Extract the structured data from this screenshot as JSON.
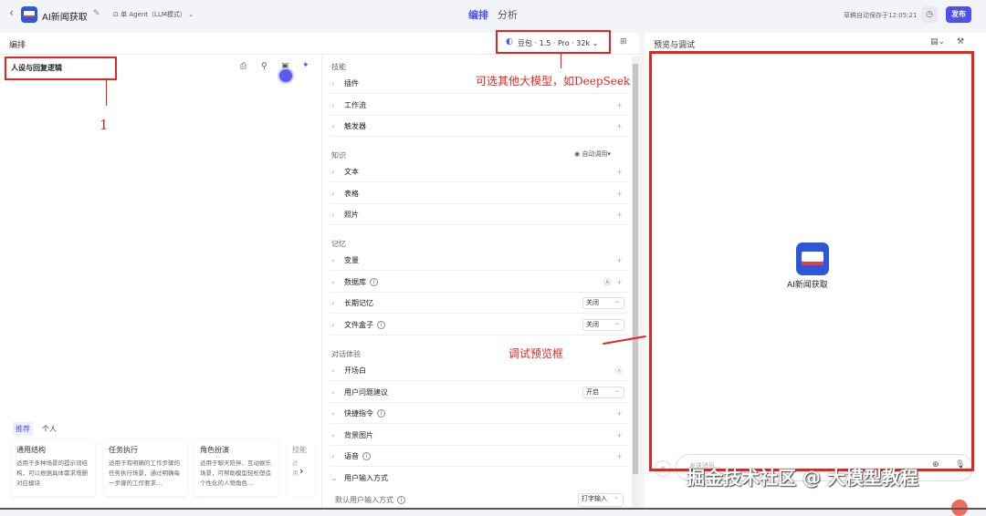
{
  "topbar": {
    "back": "‹",
    "app_name": "AI新闻获取",
    "mode": "单 Agent（LLM模式）",
    "tabs": [
      "编排",
      "分析"
    ],
    "autosave": "草稿自动保存于12:05:21",
    "publish": "发布"
  },
  "left": {
    "title": "编排",
    "persona_title": "人设与回复逻辑",
    "template_tabs": [
      "推荐",
      "个人"
    ],
    "cards": [
      {
        "title": "通用结构",
        "desc": "适用于多种场景的提示词结构，可以根据具体需求增删对应模块"
      },
      {
        "title": "任务执行",
        "desc": "适用于有明确的工作步骤的任务执行场景，通过明确每一步骤的工作要求…"
      },
      {
        "title": "角色扮演",
        "desc": "适用于聊天陪伴、互动娱乐场景，可帮助模型轻松塑造个性化的人物角色…"
      },
      {
        "title": "技能",
        "desc": "适用…"
      }
    ]
  },
  "model": {
    "label": "豆包 · 1.5 · Pro · 32k"
  },
  "mid": {
    "sections": {
      "skills": "技能",
      "knowledge": "知识",
      "memory": "记忆",
      "dialog": "对话体验"
    },
    "auto_call": "自动调用",
    "skills": [
      "插件",
      "工作流",
      "触发器"
    ],
    "knowledge": [
      "文本",
      "表格",
      "照片"
    ],
    "memory": {
      "var": "变量",
      "db": "数据库",
      "long": "长期记忆",
      "long_val": "关闭",
      "files": "文件盒子",
      "files_val": "关闭"
    },
    "dialog": {
      "opening": "开场白",
      "suggest": "用户问题建议",
      "suggest_val": "开启",
      "shortcut": "快捷指令",
      "bg": "背景图片",
      "voice": "语音",
      "input_mode": "用户输入方式",
      "default_input": "默认用户输入方式",
      "default_input_val": "打字输入"
    }
  },
  "right": {
    "title": "预览与调试",
    "bot_name": "AI新闻获取",
    "placeholder": "发送消息..."
  },
  "annotations": {
    "one": "1",
    "model_note": "可选其他大模型，如DeepSeek",
    "preview_note": "调试预览框",
    "watermark": "掘金技术社区 @ 大模型教程"
  }
}
